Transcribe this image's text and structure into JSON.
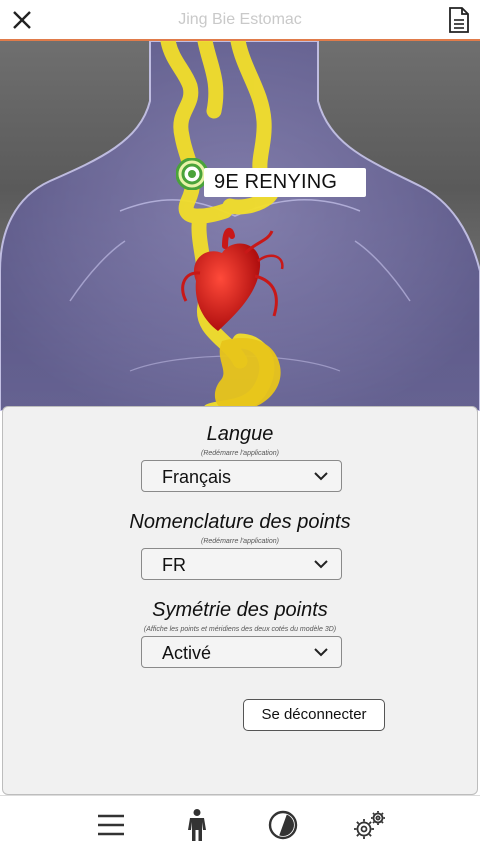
{
  "header": {
    "title": "Jing Bie Estomac",
    "close_icon": "close-icon",
    "document_icon": "document-icon"
  },
  "viewer": {
    "point_label": "9E RENYING",
    "marker_icon": "target-marker-icon"
  },
  "settings": {
    "language": {
      "title": "Langue",
      "subtitle": "(Redémarre l'application)",
      "value": "Français"
    },
    "nomenclature": {
      "title": "Nomenclature des points",
      "subtitle": "(Redémarre l'application)",
      "value": "FR"
    },
    "symmetry": {
      "title": "Symétrie des points",
      "subtitle": "(Affiche les points et méridiens des deux cotés du modèle 3D)",
      "value": "Activé"
    },
    "logout_label": "Se déconnecter"
  },
  "bottom_nav": {
    "items": [
      "menu-icon",
      "body-icon",
      "contrast-icon",
      "settings-gears-icon"
    ]
  },
  "colors": {
    "accent_line": "#e07b4a",
    "meridian_yellow": "#f2de2a",
    "heart_red": "#d81a1a"
  }
}
